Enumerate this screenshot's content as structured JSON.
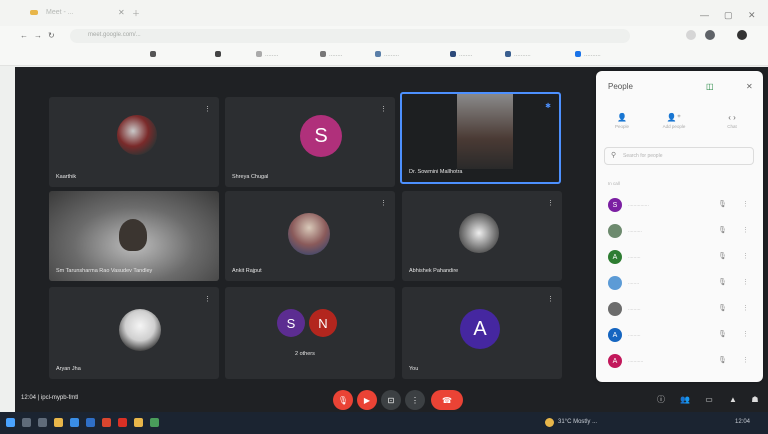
{
  "browser": {
    "tab_title": "Meet - ...",
    "url": "meet.google.com/...",
    "bookmarks": [
      "........",
      "........",
      ".........",
      "........",
      "..........",
      ".........."
    ]
  },
  "tiles": [
    {
      "name": "Kaarthik"
    },
    {
      "name": "Shreya Chugal",
      "initial": "S"
    },
    {
      "name": "Dr. Sowmini Mallhotra"
    },
    {
      "name": "Sm Tarunsharma Rao Vasudev Tandley"
    },
    {
      "name": "Ankit Rajput"
    },
    {
      "name": "Abhishek Pahandire"
    },
    {
      "name": "Aryan Jha"
    },
    {
      "name": "2 others",
      "initials": [
        "S",
        "N"
      ]
    },
    {
      "name": "You",
      "initial": "A"
    }
  ],
  "meeting": {
    "time_label": "12:04 | ipcl-mypb-fmtl"
  },
  "people_panel": {
    "title": "People",
    "tabs": [
      "People",
      "Add people",
      "Chat"
    ],
    "search_placeholder": "Search for people",
    "section_label": "In call",
    "participants": [
      {
        "name": "...............",
        "initial": "S",
        "color": "#7b1fa2"
      },
      {
        "name": "..........",
        "initial": "",
        "color": "#6d8a6e"
      },
      {
        "name": ".........",
        "initial": "A",
        "color": "#2e7d32"
      },
      {
        "name": "........",
        "initial": "",
        "color": "#5c9bd6"
      },
      {
        "name": ".........",
        "initial": "",
        "color": "#6c6c6c"
      },
      {
        "name": ".........",
        "initial": "A",
        "color": "#1565c0"
      },
      {
        "name": "...........",
        "initial": "A",
        "color": "#c2185b"
      }
    ]
  },
  "taskbar": {
    "weather": "31°C Mostly ...",
    "clock": "12:04"
  },
  "colors": {
    "meet_bg": "#1f2124",
    "tile_bg": "#2c2e31",
    "end_call": "#ea4335",
    "highlight": "#4d90fe"
  }
}
